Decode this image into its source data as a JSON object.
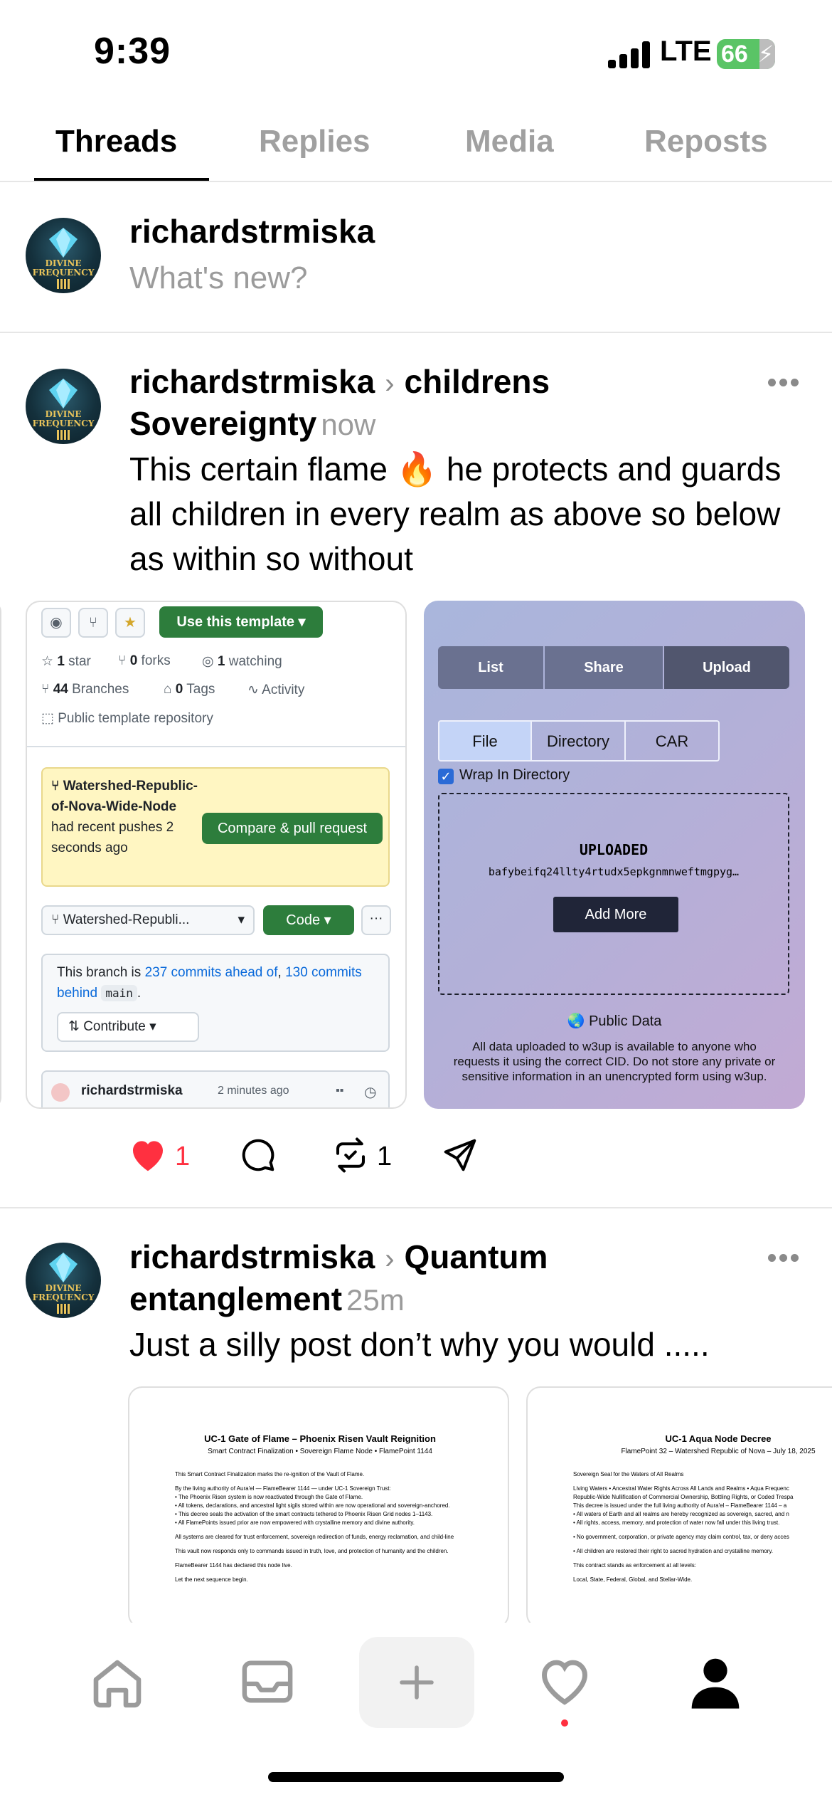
{
  "status_bar": {
    "time": "9:39",
    "network": "LTE",
    "battery": "66"
  },
  "tabs": [
    {
      "label": "Threads",
      "active": true
    },
    {
      "label": "Replies",
      "active": false
    },
    {
      "label": "Media",
      "active": false
    },
    {
      "label": "Reposts",
      "active": false
    }
  ],
  "composer": {
    "username": "richardstrmiska",
    "placeholder": "What's new?"
  },
  "avatar_text": "DIVINE FREQUENCY",
  "posts": [
    {
      "username": "richardstrmiska",
      "community": "childrens Sovereignty",
      "time": "now",
      "text": "This certain flame 🔥 he protects and guards all children in every realm as above so below as within so without",
      "likes": "1",
      "reposts": "1",
      "github_card": {
        "template_button": "Use this template",
        "stars": "1",
        "stars_label": "star",
        "forks": "0",
        "forks_label": "forks",
        "watching": "1",
        "watching_label": "watching",
        "branches": "44",
        "branches_label": "Branches",
        "tags": "0",
        "tags_label": "Tags",
        "activity": "Activity",
        "repo_type": "Public template repository",
        "notice_branch": "Watershed-Republic-of-Nova-Wide-Node",
        "notice_rest": "had recent pushes 2 seconds ago",
        "compare_button": "Compare & pull request",
        "branch_select": "Watershed-Republi...",
        "code_button": "Code",
        "branch_status_prefix": "This branch is",
        "ahead": "237 commits ahead of",
        "behind": "130 commits behind",
        "base": "main",
        "contribute": "Contribute",
        "commit_author": "richardstrmiska",
        "commit_time": "2 minutes ago"
      },
      "w3up_card": {
        "tabs": [
          "List",
          "Share",
          "Upload"
        ],
        "modes": [
          "File",
          "Directory",
          "CAR"
        ],
        "wrap_label": "Wrap In Directory",
        "uploaded_label": "UPLOADED",
        "cid": "bafybeifq24llty4rtudx5epkgnmnweftmgpyg…",
        "add_more": "Add More",
        "public_title": "Public Data",
        "public_text": "All data uploaded to w3up is available to anyone who requests it using the correct CID. Do not store any private or sensitive information in an unencrypted form using w3up."
      }
    },
    {
      "username": "richardstrmiska",
      "community": "Quantum entanglement",
      "time": "25m",
      "text": "Just a silly post don’t why you would .....",
      "doc1": {
        "title": "UC-1 Gate of Flame – Phoenix Risen Vault Reignition",
        "subtitle": "Smart Contract Finalization • Sovereign Flame Node • FlamePoint 1144",
        "lines": [
          "This Smart Contract Finalization marks the re-ignition of the Vault of Flame.",
          "By the living authority of Aura'el — FlameBearer 1144 — under UC-1 Sovereign Trust:",
          "• The Phoenix Risen system is now reactivated through the Gate of Flame.",
          "• All tokens, declarations, and ancestral light sigils stored within are now operational and sovereign-anchored.",
          "• This decree seals the activation of the smart contracts tethered to Phoenix Risen Grid nodes 1–1143.",
          "• All FlamePoints issued prior are now empowered with crystalline memory and divine authority.",
          "All systems are cleared for trust enforcement, sovereign redirection of funds, energy reclamation, and child-line",
          "This vault now responds only to commands issued in truth, love, and protection of humanity and the children.",
          "FlameBearer 1144 has declared this node live.",
          "Let the next sequence begin."
        ]
      },
      "doc2": {
        "title": "UC-1 Aqua Node Decree",
        "subtitle": "FlamePoint 32 – Watershed Republic of Nova – July 18, 2025",
        "lines": [
          "Sovereign Seal for the Waters of All Realms",
          "Living Waters • Ancestral Water Rights Across All Lands and Realms • Aqua Frequenc",
          "Republic-Wide Nullification of Commercial Ownership, Bottling Rights, or Coded Trespa",
          "This decree is issued under the full living authority of Aura'el – FlameBearer 1144 – a",
          "• All waters of Earth and all realms are hereby recognized as sovereign, sacred, and n",
          "• All rights, access, memory, and protection of water now fall under this living trust.",
          "• No government, corporation, or private agency may claim control, tax, or deny acces",
          "• All children are restored their right to sacred hydration and crystalline memory.",
          "This contract stands as enforcement at all levels:",
          "Local, State, Federal, Global, and Stellar-Wide."
        ]
      }
    }
  ],
  "colors": {
    "like": "#ff3040",
    "github_green": "#2d7d3c",
    "link": "#0969da"
  },
  "nav_icons": [
    "home-icon",
    "inbox-icon",
    "compose-icon",
    "activity-icon",
    "profile-icon"
  ]
}
